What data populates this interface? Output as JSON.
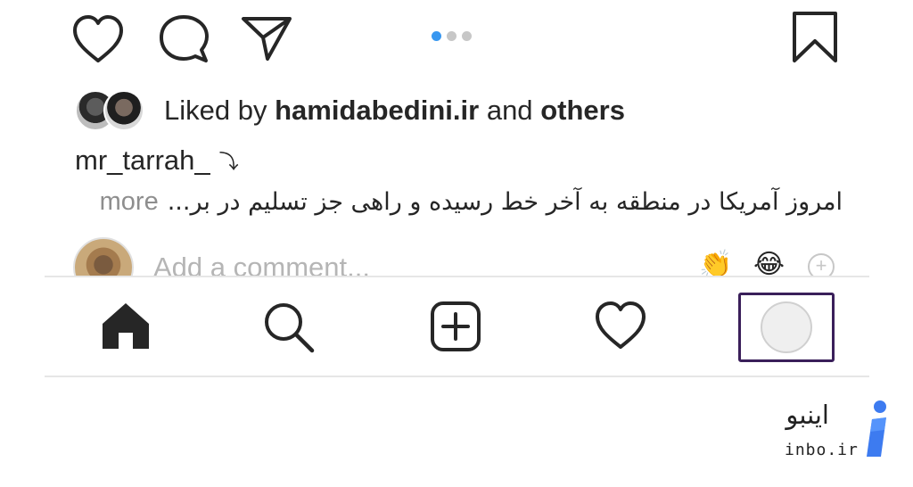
{
  "post": {
    "liked_by_prefix": "Liked by",
    "liked_by_user": "hamidabedini.ir",
    "liked_by_and": "and",
    "liked_by_others": "others",
    "caption_user": "mr_tarrah_",
    "caption_arrow": "⤵",
    "caption_text": "امروز آمریکا در منطقه به آخر خط رسیده و راهی جز تسلیم در بر...",
    "caption_more": "more",
    "comment_placeholder": "Add a comment...",
    "quick_emojis": [
      "👏",
      "😂"
    ],
    "add_emoji": "+",
    "carousel": {
      "total": 3,
      "active": 1
    }
  },
  "icons": {
    "like": "heart-icon",
    "comment": "comment-bubble-icon",
    "share": "paper-plane-icon",
    "save": "bookmark-icon"
  },
  "nav": {
    "items": [
      "home-icon",
      "search-icon",
      "new-post-icon",
      "activity-heart-icon",
      "profile-avatar"
    ],
    "active": "home",
    "highlight_color": "#3a1f5a"
  },
  "watermark": {
    "fa": "اینبو",
    "en": "inbo.ir",
    "logo_color": "#3d7bf0"
  },
  "colors": {
    "carousel_active": "#3897f0",
    "carousel_inactive": "#c7c7c7",
    "text": "#262626",
    "muted": "#8e8e8e"
  }
}
